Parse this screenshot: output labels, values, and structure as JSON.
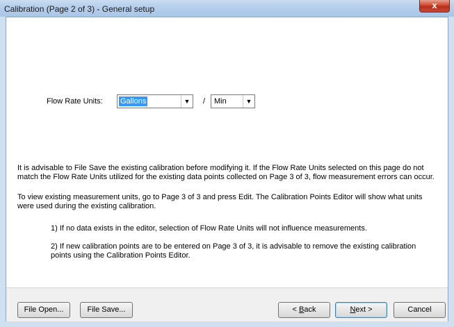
{
  "window": {
    "title": "Calibration (Page 2 of 3) - General setup",
    "close_glyph": "x"
  },
  "flow": {
    "label": "Flow Rate Units:",
    "unit_value": "Gallons",
    "separator": "/",
    "time_value": "Min"
  },
  "info": {
    "para1": "It is advisable to File Save the existing calibration before modifying it.  If the Flow Rate Units selected on this page do not match the Flow Rate Units utilized for the existing data points collected on Page 3 of 3, flow measurement errors can occur.",
    "para2": "To view existing measurement units, go to Page 3 of 3 and press Edit.  The Calibration Points Editor will show what units were used during the existing calibration.",
    "note1": "1)  If no data exists in the editor, selection of Flow Rate Units will not influence measurements.",
    "note2": "2)  If new calibration points are to be entered on Page 3 of 3, it is advisable to remove the existing calibration points using the Calibration Points Editor."
  },
  "buttons": {
    "file_open": "File Open...",
    "file_save": "File Save...",
    "back_prefix": "< ",
    "back_acc": "B",
    "back_rest": "ack",
    "next_acc": "N",
    "next_rest": "ext >",
    "cancel": "Cancel"
  },
  "colors": {
    "selection": "#3399ff",
    "title_gradient": "#b6cfeb",
    "close_button": "#d0492f"
  },
  "icons": {
    "dropdown": "chevron-down-icon",
    "close": "close-icon"
  }
}
